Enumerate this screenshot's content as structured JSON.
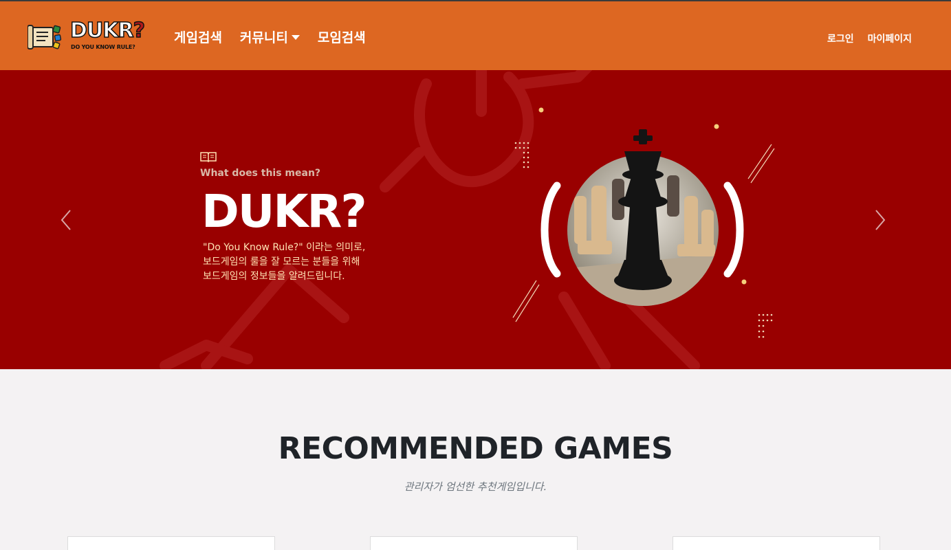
{
  "navbar": {
    "logo": {
      "main": "DUKR",
      "question_mark": "?",
      "sub": "DO YOU KNOW RULE?"
    },
    "menu": [
      {
        "label": "게임검색",
        "dropdown": false
      },
      {
        "label": "커뮤니티",
        "dropdown": true
      },
      {
        "label": "모임검색",
        "dropdown": false
      }
    ],
    "right_links": [
      {
        "label": "로그인"
      },
      {
        "label": "마이페이지"
      }
    ],
    "background_color": "#dd6722"
  },
  "hero": {
    "background_color": "#990000",
    "question": "What does this mean?",
    "title": "DUKR?",
    "description_lines": [
      "\"Do You Know Rule?\" 이라는 의미로,",
      "보드게임의 룰을 잘 모르는 분들을 위해",
      "보드게임의 정보들을 알려드립니다."
    ],
    "icons": {
      "book": "book-icon",
      "prev": "chevron-left-icon",
      "next": "chevron-right-icon"
    },
    "image": "chess-king-image"
  },
  "recommended": {
    "title": "RECOMMENDED GAMES",
    "subtitle": "관리자가 엄선한 추천게임입니다.",
    "cards_visible": 3
  }
}
